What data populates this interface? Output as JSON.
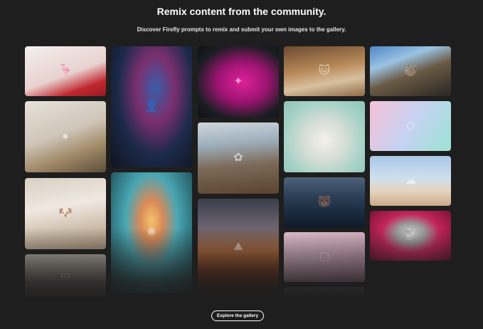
{
  "header": {
    "title": "Remix content from the community.",
    "subtitle": "Discover Firefly prompts to remix and submit your own images to the gallery."
  },
  "gallery": {
    "tiles": [
      {
        "name": "gallery-image-flamingo",
        "icon": "flamingo-image-icon",
        "glyph": "🦩",
        "bg": "linear-gradient(160deg,#f3f0ee 0%,#e9d2cf 55%,#c0272d 80%,#8f1c22 100%)"
      },
      {
        "name": "gallery-image-crystal-head",
        "icon": "portrait-image-icon",
        "glyph": "👤",
        "bg": "radial-gradient(ellipse at 55% 35%,#3a5ea8 0%,#7a2f6e 30%,#1b2a4a 60%,#10131c 100%)"
      },
      {
        "name": "gallery-image-pink-smoke",
        "icon": "smoke-image-icon",
        "glyph": "✦",
        "bg": "radial-gradient(ellipse at 55% 50%,#e0209a 0%,#9b1470 40%,#1a1d22 75%,#0e1013 100%)"
      },
      {
        "name": "gallery-image-cat-bath",
        "icon": "cat-image-icon",
        "glyph": "🐱",
        "bg": "linear-gradient(170deg,#6b4a2f 0%,#b98a5a 45%,#d8c1a0 70%,#8e6a45 100%)"
      },
      {
        "name": "gallery-image-sloth-car",
        "icon": "sloth-image-icon",
        "glyph": "🦥",
        "bg": "linear-gradient(160deg,#4f86c6 0%,#9bc3e2 30%,#6a5a45 55%,#2a2622 100%)"
      },
      {
        "name": "gallery-image-gold-stones",
        "icon": "stones-image-icon",
        "glyph": "●",
        "bg": "linear-gradient(160deg,#e8e2da 0%,#cfc6b9 45%,#a38c6a 70%,#5c4d3a 100%)"
      },
      {
        "name": "gallery-image-glass-flower",
        "icon": "flower-image-icon",
        "glyph": "✿",
        "bg": "linear-gradient(175deg,#cfd6dc 0%,#9eb0bd 30%,#7c6a58 60%,#5a4330 100%)"
      },
      {
        "name": "gallery-image-pearl-ornament",
        "icon": "ornament-image-icon",
        "glyph": "○",
        "bg": "radial-gradient(ellipse at 50% 55%,#f4f1ea 0%,#d7ded7 35%,#a6d2c6 70%,#8cc4b6 100%)"
      },
      {
        "name": "gallery-image-glass-chair",
        "icon": "chair-image-icon",
        "glyph": "◇",
        "bg": "linear-gradient(120deg,#f6c0d6 0%,#c6d2f2 50%,#9be3d4 100%)"
      },
      {
        "name": "gallery-image-puppy-bed",
        "icon": "puppy-image-icon",
        "glyph": "🐶",
        "bg": "linear-gradient(170deg,#d9cfc3 0%,#efe9e2 40%,#c9b9a5 75%,#a9947c 100%)"
      },
      {
        "name": "gallery-image-dandelion",
        "icon": "dandelion-image-icon",
        "glyph": "✺",
        "bg": "radial-gradient(ellipse at 50% 40%,#f5c36a 0%,#d98a5a 20%,#4aa7b3 45%,#2b6d77 75%,#1c3a40 100%)"
      },
      {
        "name": "gallery-image-polar-bear",
        "icon": "bear-image-icon",
        "glyph": "🐻",
        "bg": "linear-gradient(180deg,#4d6278 0%,#2a3e55 40%,#1a2b40 70%,#0f1a28 100%)"
      },
      {
        "name": "gallery-image-cloud-cup",
        "icon": "cup-image-icon",
        "glyph": "☁",
        "bg": "linear-gradient(180deg,#a9c7e6 0%,#cfe0ee 45%,#e5d4bd 70%,#c9a987 100%)"
      },
      {
        "name": "gallery-image-woman-volcano",
        "icon": "landscape-image-icon",
        "glyph": "⛰",
        "bg": "linear-gradient(180deg,#3a3f4a 0%,#6b6470 30%,#b06a3a 55%,#7a2f14 80%,#3b1a10 100%)"
      },
      {
        "name": "gallery-image-pink-room",
        "icon": "room-image-icon",
        "glyph": "▢",
        "bg": "linear-gradient(160deg,#e6c7d4 0%,#d9b0c2 50%,#c58ea6 100%)"
      },
      {
        "name": "gallery-image-poodle-tulips",
        "icon": "poodle-image-icon",
        "glyph": "🐩",
        "bg": "radial-gradient(ellipse at 50% 45%,#cfcfcf 0%,#9a9a9a 25%,#c2255a 50%,#8e1740 80%,#5c0f2a 100%)"
      },
      {
        "name": "gallery-image-table-setting",
        "icon": "table-image-icon",
        "glyph": "▭",
        "bg": "linear-gradient(180deg,#bfb8ae 0%,#9c9184 60%,#6e6458 100%)"
      },
      {
        "name": "gallery-image-partial",
        "icon": "image-icon",
        "glyph": "",
        "bg": "linear-gradient(180deg,#6a6a6a 0%,#3a3a3a 100%)"
      }
    ]
  },
  "explore_button": {
    "label": "Explore the gallery"
  }
}
